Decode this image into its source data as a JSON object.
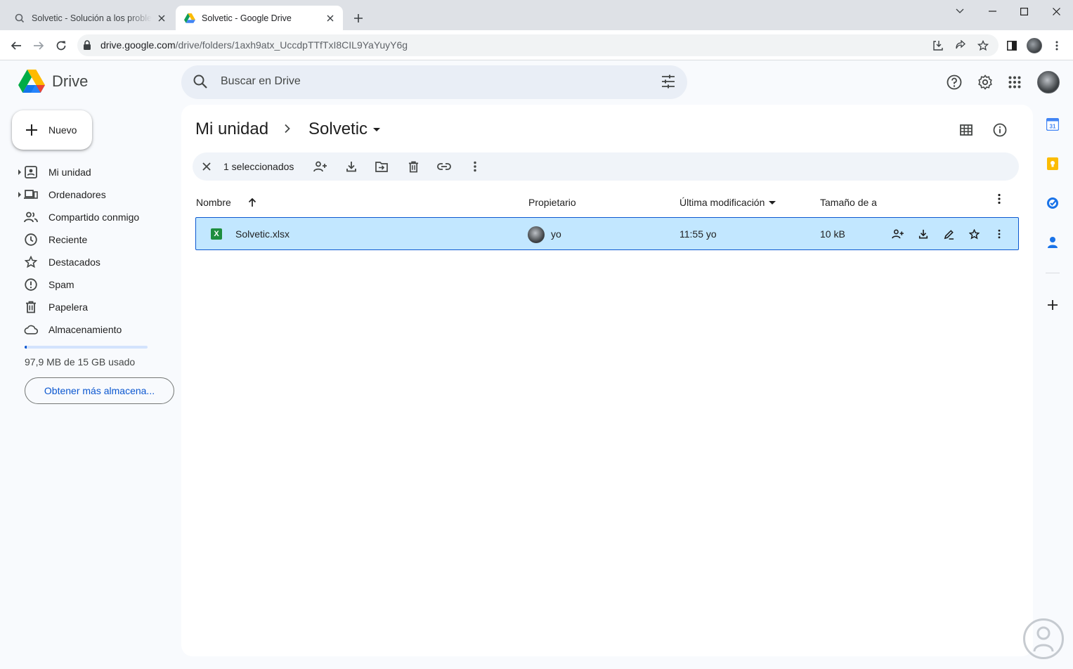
{
  "browser": {
    "tabs": [
      {
        "title": "Solvetic - Solución a los problem",
        "active": false
      },
      {
        "title": "Solvetic - Google Drive",
        "active": true
      }
    ],
    "url_host": "drive.google.com",
    "url_path": "/drive/folders/1axh9atx_UccdpTTfTxI8CIL9YaYuyY6g"
  },
  "drive": {
    "logo_text": "Drive",
    "search_placeholder": "Buscar en Drive",
    "new_label": "Nuevo",
    "nav": [
      {
        "label": "Mi unidad",
        "icon": "my-drive-icon"
      },
      {
        "label": "Ordenadores",
        "icon": "computers-icon"
      },
      {
        "label": "Compartido conmigo",
        "icon": "shared-icon"
      },
      {
        "label": "Reciente",
        "icon": "clock-icon"
      },
      {
        "label": "Destacados",
        "icon": "star-icon"
      },
      {
        "label": "Spam",
        "icon": "spam-icon"
      },
      {
        "label": "Papelera",
        "icon": "trash-icon"
      },
      {
        "label": "Almacenamiento",
        "icon": "cloud-icon"
      }
    ],
    "storage": {
      "used_text": "97,9 MB de 15 GB usado",
      "fraction": 0.0065,
      "button": "Obtener más almacena..."
    },
    "breadcrumb": {
      "root": "Mi unidad",
      "current": "Solvetic"
    },
    "selection": {
      "count_label": "1 seleccionados"
    },
    "columns": {
      "name": "Nombre",
      "owner": "Propietario",
      "modified": "Última modificación",
      "size": "Tamaño de a"
    },
    "files": [
      {
        "name": "Solvetic.xlsx",
        "owner": "yo",
        "modified": "11:55 yo",
        "size": "10 kB",
        "type_glyph": "X"
      }
    ]
  },
  "colors": {
    "accent": "#0b57d0",
    "selected_row": "#c2e7ff",
    "app_bg": "#f8fafd"
  }
}
